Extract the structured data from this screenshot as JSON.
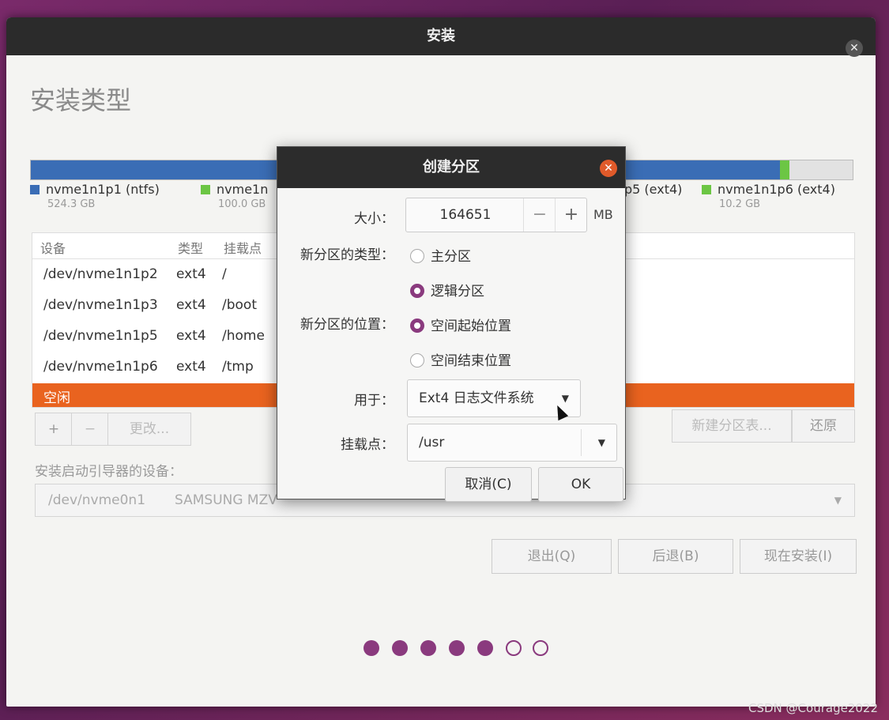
{
  "window": {
    "title": "安装",
    "close_icon": "close-icon"
  },
  "page_title": "安装类型",
  "partitions_legend": [
    {
      "name": "nvme1n1p1 (ntfs)",
      "size": "524.3 GB",
      "color": "#3a6db5"
    },
    {
      "name": "nvme1n",
      "size": "100.0 GB",
      "color": "#6cc644"
    },
    {
      "name": "p5 (ext4)",
      "size": "",
      "color": "#3a6db5"
    },
    {
      "name": "nvme1n1p6 (ext4)",
      "size": "10.2 GB",
      "color": "#6cc644"
    }
  ],
  "table": {
    "headers": [
      "设备",
      "类型",
      "挂载点"
    ],
    "rows": [
      {
        "device": "/dev/nvme1n1p2",
        "type": "ext4",
        "mount": "/"
      },
      {
        "device": "/dev/nvme1n1p3",
        "type": "ext4",
        "mount": "/boot"
      },
      {
        "device": "/dev/nvme1n1p5",
        "type": "ext4",
        "mount": "/home"
      },
      {
        "device": "/dev/nvme1n1p6",
        "type": "ext4",
        "mount": "/tmp"
      }
    ],
    "free_label": "空闲"
  },
  "toolbar": {
    "add": "+",
    "remove": "−",
    "change": "更改...",
    "new_table": "新建分区表...",
    "revert": "还原"
  },
  "bootloader": {
    "label": "安装启动引导器的设备：",
    "device": "/dev/nvme0n1",
    "model": "SAMSUNG MZV"
  },
  "nav": {
    "quit": "退出(Q)",
    "back": "后退(B)",
    "install": "现在安装(I)"
  },
  "progress": {
    "total_steps": 7,
    "completed_steps": 5
  },
  "dialog": {
    "title": "创建分区",
    "size_label": "大小：",
    "size_value": "164651",
    "size_minus": "−",
    "size_plus": "+",
    "size_unit": "MB",
    "type_label": "新分区的类型：",
    "type_primary": "主分区",
    "type_logical": "逻辑分区",
    "type_selected": "logical",
    "location_label": "新分区的位置：",
    "location_begin": "空间起始位置",
    "location_end": "空间结束位置",
    "location_selected": "begin",
    "use_label": "用于：",
    "use_value": "Ext4 日志文件系统",
    "mount_label": "挂载点：",
    "mount_value": "/usr",
    "cancel": "取消(C)",
    "ok": "OK"
  },
  "watermark": "CSDN @Courage2022"
}
